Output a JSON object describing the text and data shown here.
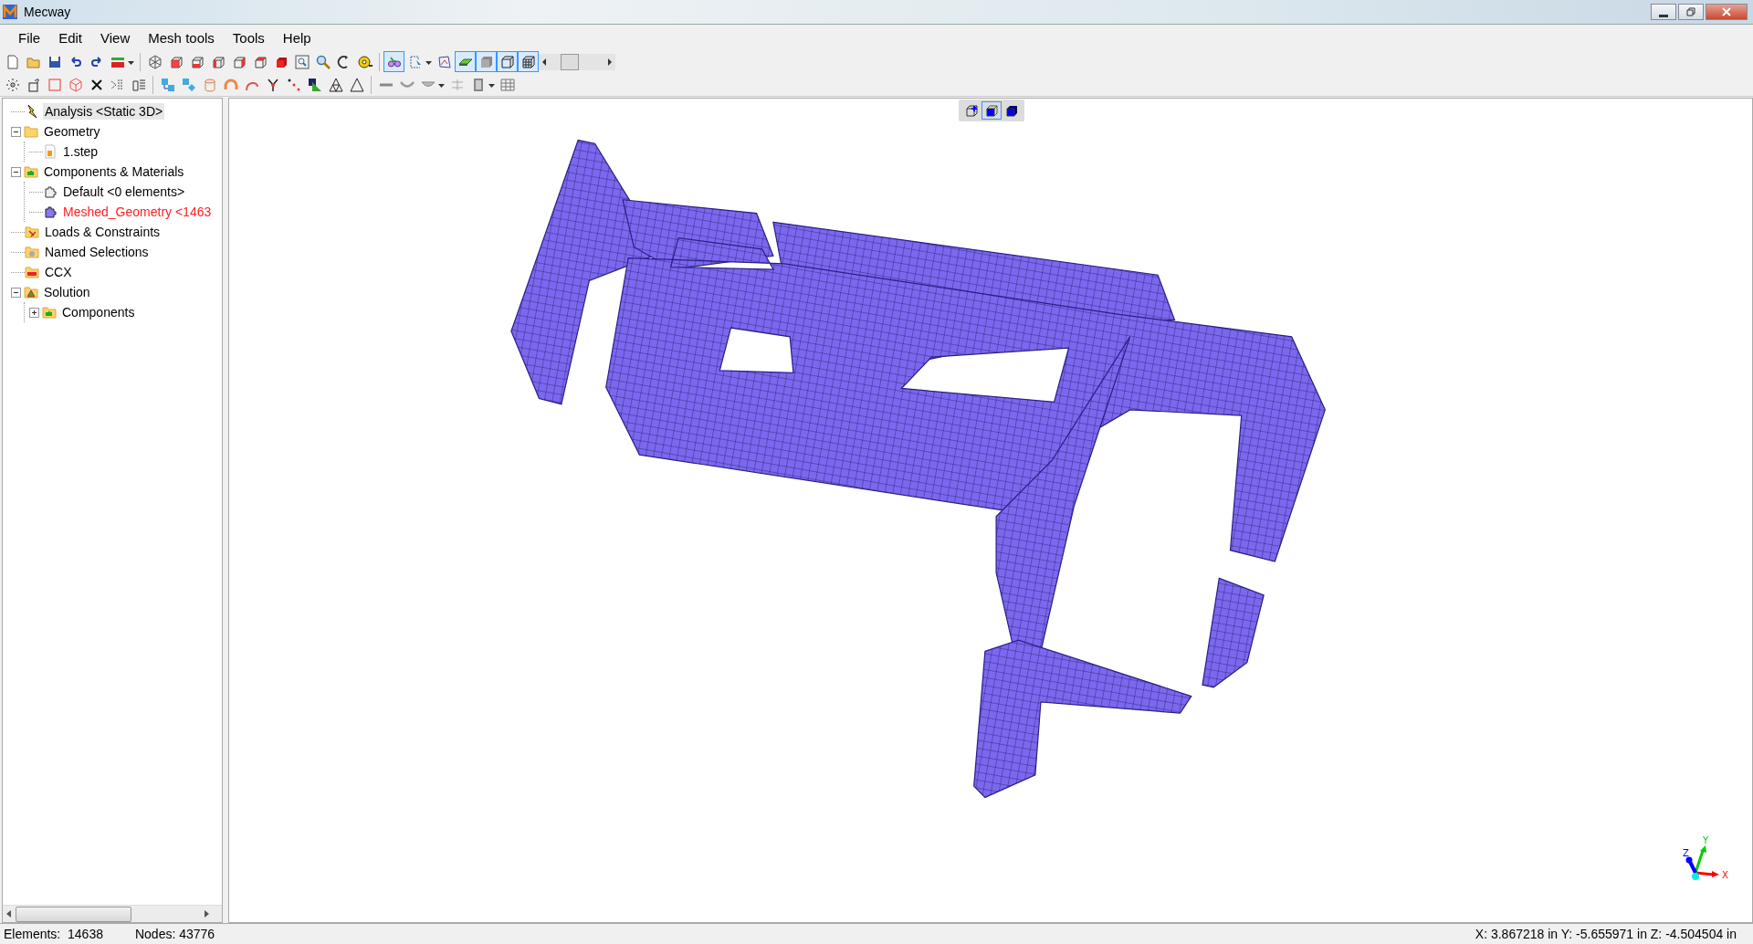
{
  "window": {
    "title": "Mecway"
  },
  "menu": [
    "File",
    "Edit",
    "View",
    "Mesh tools",
    "Tools",
    "Help"
  ],
  "toolbar_1": [
    {
      "kind": "new",
      "selected": false
    },
    {
      "kind": "open",
      "selected": false
    },
    {
      "kind": "save",
      "selected": false
    },
    {
      "kind": "undo",
      "selected": false
    },
    {
      "kind": "redo",
      "selected": false
    },
    {
      "kind": "box",
      "selected": false,
      "dropdown": true
    },
    {
      "kind": "sep"
    },
    {
      "kind": "iso",
      "selected": false
    },
    {
      "kind": "cube-front",
      "selected": false
    },
    {
      "kind": "cube-bottom",
      "selected": false
    },
    {
      "kind": "cube-left",
      "selected": false
    },
    {
      "kind": "cube-right",
      "selected": false
    },
    {
      "kind": "cube-top",
      "selected": false
    },
    {
      "kind": "cube-solid",
      "selected": false
    },
    {
      "kind": "zoom-box",
      "selected": false
    },
    {
      "kind": "magnify",
      "selected": false
    },
    {
      "kind": "rotate",
      "selected": false
    },
    {
      "kind": "measure",
      "selected": false
    },
    {
      "kind": "sep"
    },
    {
      "kind": "glasses",
      "selected": true
    },
    {
      "kind": "pointer",
      "selected": false,
      "dropdown": true
    },
    {
      "kind": "sketch",
      "selected": false
    },
    {
      "kind": "shaded",
      "selected": true
    },
    {
      "kind": "solid-grey",
      "selected": true
    },
    {
      "kind": "wire",
      "selected": true
    },
    {
      "kind": "mesh",
      "selected": true
    },
    {
      "kind": "slider"
    }
  ],
  "toolbar_2": [
    {
      "kind": "nodes",
      "selected": false
    },
    {
      "kind": "node-box",
      "selected": false
    },
    {
      "kind": "square",
      "selected": false
    },
    {
      "kind": "cube-wire",
      "selected": false
    },
    {
      "kind": "cross",
      "selected": false
    },
    {
      "kind": "split",
      "selected": false
    },
    {
      "kind": "extrude",
      "selected": false
    },
    {
      "kind": "sep"
    },
    {
      "kind": "move",
      "selected": false
    },
    {
      "kind": "copy",
      "selected": false
    },
    {
      "kind": "cylinder",
      "selected": false
    },
    {
      "kind": "bend",
      "selected": false
    },
    {
      "kind": "sweep",
      "selected": false
    },
    {
      "kind": "merge",
      "selected": false
    },
    {
      "kind": "dots",
      "selected": false
    },
    {
      "kind": "scale",
      "selected": false
    },
    {
      "kind": "triangle-mesh",
      "selected": false
    },
    {
      "kind": "triangle",
      "selected": false
    },
    {
      "kind": "sep"
    },
    {
      "kind": "bar",
      "selected": false
    },
    {
      "kind": "curve",
      "selected": false
    },
    {
      "kind": "shell",
      "selected": false,
      "dropdown": true
    },
    {
      "kind": "align",
      "selected": false
    },
    {
      "kind": "film",
      "selected": false,
      "dropdown": true
    },
    {
      "kind": "table",
      "selected": false
    }
  ],
  "tree": [
    {
      "label": "Analysis <Static 3D>",
      "kind": "analysis",
      "selected": true,
      "highlighted": false
    },
    {
      "label": "Geometry",
      "kind": "folder",
      "selected": false,
      "highlighted": false,
      "expanded": true,
      "children": [
        {
          "label": "1.step",
          "kind": "file",
          "selected": false,
          "highlighted": false
        }
      ]
    },
    {
      "label": "Components & Materials",
      "kind": "components",
      "selected": false,
      "highlighted": false,
      "expanded": true,
      "children": [
        {
          "label": "Default <0 elements>",
          "kind": "part-grey",
          "selected": false,
          "highlighted": false
        },
        {
          "label": "Meshed_Geometry <1463",
          "kind": "part-blue",
          "selected": false,
          "highlighted": true
        }
      ]
    },
    {
      "label": "Loads & Constraints",
      "kind": "loads",
      "selected": false,
      "highlighted": false
    },
    {
      "label": "Named Selections",
      "kind": "selections",
      "selected": false,
      "highlighted": false
    },
    {
      "label": "CCX",
      "kind": "ccx",
      "selected": false,
      "highlighted": false
    },
    {
      "label": "Solution",
      "kind": "solution",
      "selected": false,
      "highlighted": false,
      "expanded": true,
      "children": [
        {
          "label": "Components",
          "kind": "components",
          "selected": false,
          "highlighted": false,
          "expanded": false
        }
      ]
    }
  ],
  "view_buttons": [
    {
      "kind": "cube-point",
      "selected": false
    },
    {
      "kind": "cube-face",
      "selected": true
    },
    {
      "kind": "cube-solid",
      "selected": false
    }
  ],
  "axes": {
    "x": "X",
    "y": "Y",
    "z": "Z"
  },
  "status_bar": {
    "elements": "Elements:  14638",
    "nodes": "Nodes: 43776",
    "coordinates": "X: 3.867218 in Y: -5.655971 in Z: -4.504504 in"
  }
}
